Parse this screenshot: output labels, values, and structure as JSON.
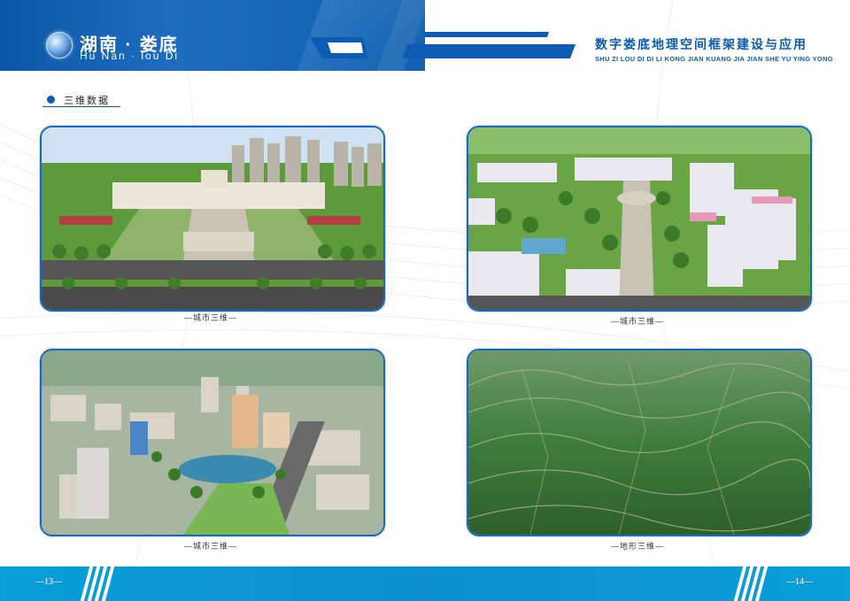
{
  "header": {
    "brand_cn": "湖南 · 娄底",
    "brand_en": "Hu Nan · lou Di",
    "title_cn": "数字娄底地理空间框架建设与应用",
    "title_en": "SHU ZI LOU DI DI LI KONG JIAN KUANG JIA JIAN SHE YU YING YONG",
    "brand_color": "#0d5cb3"
  },
  "section": {
    "label": "三维数据"
  },
  "panels": [
    {
      "caption": "—城市三维—",
      "scene": "city-square-3d"
    },
    {
      "caption": "—城市三维—",
      "scene": "campus-3d"
    },
    {
      "caption": "—城市三维—",
      "scene": "city-lake-3d"
    },
    {
      "caption": "—地形三维—",
      "scene": "terrain-3d"
    }
  ],
  "footer": {
    "page_left": "—13—",
    "page_right": "—14—",
    "color": "#0a9fd8"
  }
}
